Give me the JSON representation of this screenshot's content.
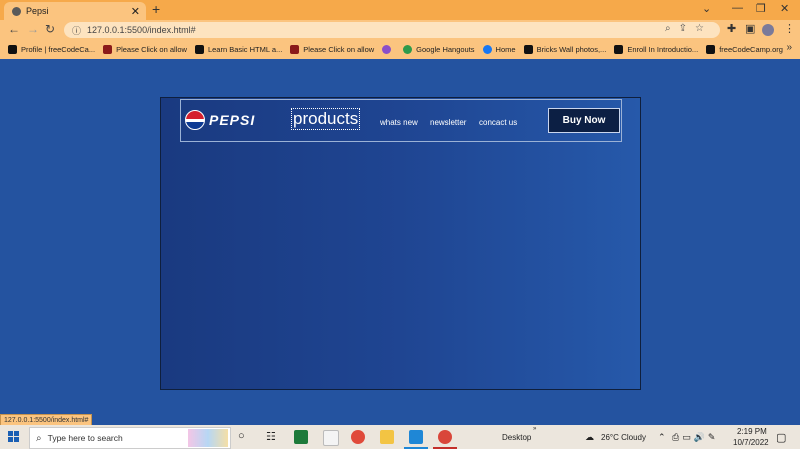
{
  "browser": {
    "tab_title": "Pepsi",
    "new_tab": "+",
    "url": "127.0.0.1:5500/index.html#",
    "bookmarks": [
      "Profile | freeCodeCa...",
      "Please Click on allow",
      "Learn Basic HTML a...",
      "Please Click on allow",
      "",
      "Google Hangouts",
      "Home",
      "Bricks Wall photos,...",
      "Enroll In Introductio...",
      "freeCodeCamp.org"
    ],
    "status_url": "127.0.0.1:5500/index.html#"
  },
  "site": {
    "logo_text": "PEPSI",
    "nav": {
      "products": "products",
      "whats_new": "whats new",
      "newsletter": "newsletter",
      "contact": "concact us"
    },
    "buy_button": "Buy Now"
  },
  "taskbar": {
    "search_placeholder": "Type here to search",
    "desktop_label": "Desktop",
    "weather": "26°C  Cloudy",
    "time": "2:19 PM",
    "date": "10/7/2022"
  },
  "colors": {
    "page_bg": "#2453a0",
    "chrome_orange": "#f6a94a",
    "button_bg": "#0c1f44"
  }
}
